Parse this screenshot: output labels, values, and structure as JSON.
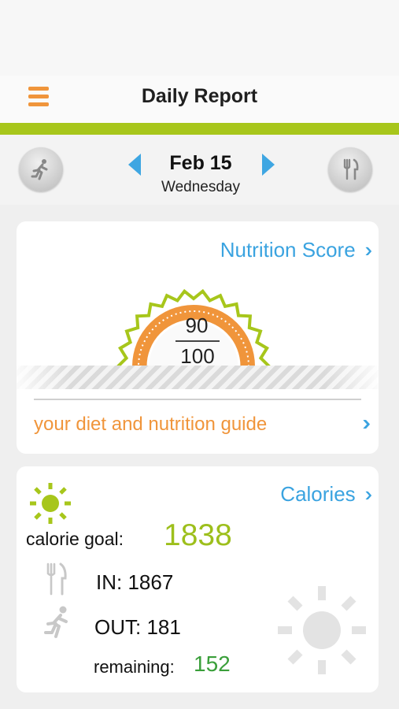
{
  "header": {
    "title": "Daily Report",
    "menu_icon": "hamburger-menu-icon"
  },
  "colors": {
    "accent_orange": "#f0953b",
    "accent_green": "#a7c61b",
    "link_blue": "#3aa3e0",
    "remaining_green": "#3a9f3a"
  },
  "date_nav": {
    "date": "Feb 15",
    "weekday": "Wednesday",
    "left_icon": "running-person-icon",
    "right_icon": "fork-knife-icon"
  },
  "nutrition": {
    "link_label": "Nutrition Score",
    "score": "90",
    "max": "100",
    "guide_label": "your diet and nutrition guide"
  },
  "calories": {
    "link_label": "Calories",
    "goal_label": "calorie goal:",
    "goal_value": "1838",
    "in_text": "IN: 1867",
    "out_text": "OUT: 181",
    "remaining_label": "remaining:",
    "remaining_value": "152"
  }
}
